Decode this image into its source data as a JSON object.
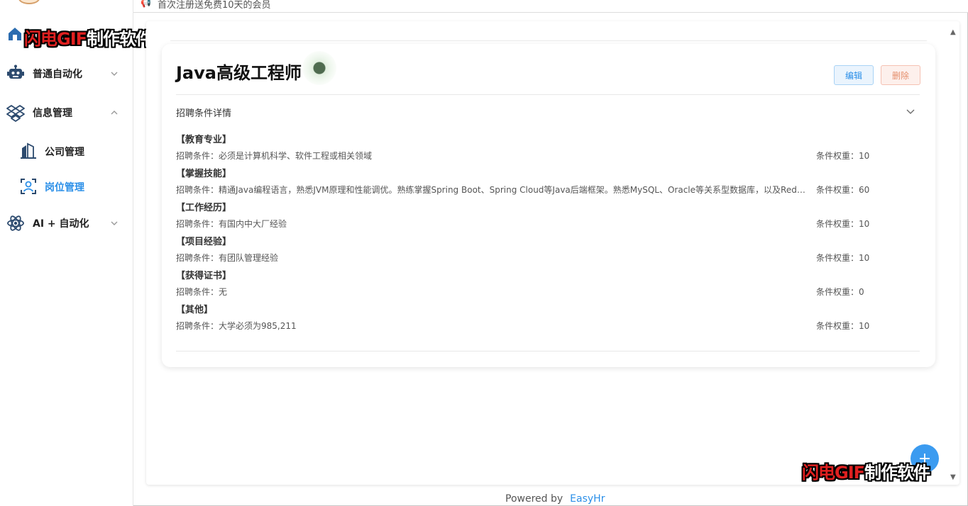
{
  "topbar": {
    "notice": "首次注册送免费10天的会员"
  },
  "watermark": {
    "part1": "闪电GIF",
    "part2": "制作软件"
  },
  "sidebar": {
    "items": [
      {
        "label": "普通自动化",
        "icon": "robot-icon",
        "expanded": false
      },
      {
        "label": "信息管理",
        "icon": "dropbox-icon",
        "expanded": true
      },
      {
        "label": "AI + 自动化",
        "icon": "atom-icon",
        "expanded": false
      }
    ],
    "sub_items": [
      {
        "label": "公司管理",
        "icon": "building-icon",
        "active": false
      },
      {
        "label": "岗位管理",
        "icon": "face-scan-icon",
        "active": true
      }
    ]
  },
  "job": {
    "title": "Java高级工程师",
    "edit_label": "编辑",
    "delete_label": "删除",
    "collapse_title": "招聘条件详情",
    "sections": [
      {
        "heading": "【教育专业】",
        "condition": "招聘条件：必须是计算机科学、软件工程或相关领域",
        "weight": "条件权重：10"
      },
      {
        "heading": "【掌握技能】",
        "condition": "招聘条件：精通Java编程语言，熟悉JVM原理和性能调优。熟练掌握Spring Boot、Spring Cloud等Java后端框架。熟悉MySQL、Oracle等关系型数据库，以及Redis…",
        "weight": "条件权重：60"
      },
      {
        "heading": "【工作经历】",
        "condition": "招聘条件：有国内中大厂经验",
        "weight": "条件权重：10"
      },
      {
        "heading": "【项目经验】",
        "condition": "招聘条件：有团队管理经验",
        "weight": "条件权重：10"
      },
      {
        "heading": "【获得证书】",
        "condition": "招聘条件：无",
        "weight": "条件权重：0"
      },
      {
        "heading": "【其他】",
        "condition": "招聘条件：大学必须为985,211",
        "weight": "条件权重：10"
      }
    ]
  },
  "fab": {
    "label": "+"
  },
  "footer": {
    "powered": "Powered by",
    "brand": "EasyHr"
  },
  "colors": {
    "accent": "#2b8fe8",
    "danger": "#e58f6d"
  }
}
